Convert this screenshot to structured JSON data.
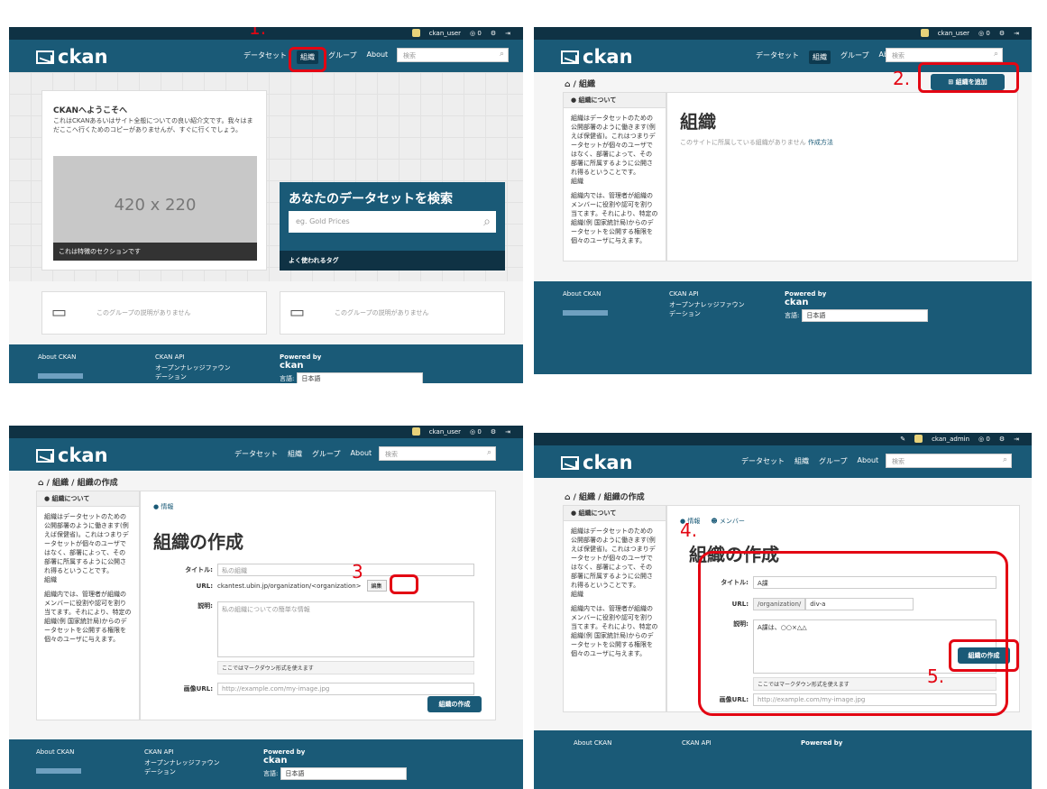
{
  "annotations": {
    "step1": "1.",
    "step2": "2.",
    "step3": "3",
    "step4": "4.",
    "step5": "5."
  },
  "common": {
    "logo": "ckan",
    "nav_dataset": "データセット",
    "nav_org": "組織",
    "nav_group": "グループ",
    "nav_about": "About",
    "search_placeholder": "検索",
    "user": "ckan_user",
    "admin": "ckan_admin",
    "count": "0",
    "footer_about": "About CKAN",
    "footer_api": "CKAN API",
    "footer_license": "オープンナレッジファウンデーション",
    "powered_by": "Powered by",
    "lang_label": "言語:",
    "lang_value": "日本語"
  },
  "panel1": {
    "welcome_title": "CKANへようこそへ",
    "welcome_text": "これはCKANあるいはサイト全般についての良い紹介文です。我々はまだここへ行くためのコピーがありませんが、すぐに行くでしょう。",
    "placeholder_image": "420 x 220",
    "feature_caption": "これは特徴のセクションです",
    "search_title": "あなたのデータセットを検索",
    "search_input_placeholder": "eg. Gold Prices",
    "popular_tags": "よく使われるタグ",
    "group_empty_1": "このグループの説明がありません",
    "group_empty_2": "このグループの説明がありません"
  },
  "panel2": {
    "breadcrumb": "組織",
    "add_button": "組織を追加",
    "side_header": "組織について",
    "side_text_1": "組織はデータセットのための公開部署のように働きます(例えば保健省)。これはつまりデータセットが個々のユーザではなく、部署によって、その部署に所属するように公開され得るということです。",
    "side_text_1b": "組織",
    "side_text_2": "組織内では、管理者が組織のメンバーに役割や認可を割り当てます。それにより、特定の組織(例 国家統計局)からのデータセットを公開する権限を個々のユーザに与えます。",
    "title": "組織",
    "empty_text": "このサイトに所属している組織がありません",
    "how_to": "作成方法"
  },
  "panel3": {
    "breadcrumb_1": "組織",
    "breadcrumb_2": "組織の作成",
    "tab_info": "情報",
    "title": "組織の作成",
    "label_title": "タイトル:",
    "placeholder_title": "私の組織",
    "label_url": "URL:",
    "url_text": "ckantest.ubin.jp/organization/<organization>",
    "edit_button": "編集",
    "label_desc": "説明:",
    "placeholder_desc": "私の組織についての簡単な情報",
    "markdown_note": "ここではマークダウン形式を使えます",
    "label_image": "画像URL:",
    "placeholder_image": "http://example.com/my-image.jpg",
    "submit": "組織の作成"
  },
  "panel4": {
    "tab_members": "メンバー",
    "value_title": "A課",
    "url_prefix": "/organization/",
    "url_value": "div-a",
    "value_desc": "A課は、○○×△△"
  }
}
